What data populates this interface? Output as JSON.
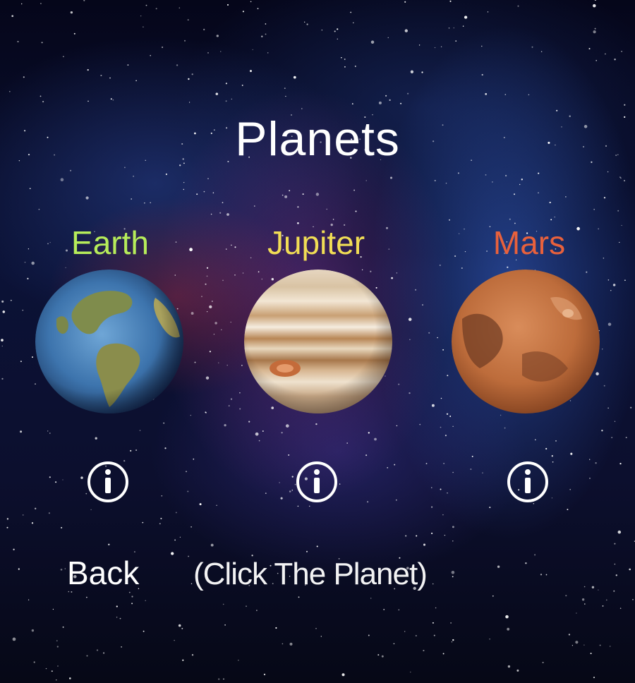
{
  "screen": {
    "title": "Planets"
  },
  "planets": [
    {
      "name": "Earth",
      "color": "#b6ec5a"
    },
    {
      "name": "Jupiter",
      "color": "#f1dd55"
    },
    {
      "name": "Mars",
      "color": "#e8613c"
    }
  ],
  "info_icon": "info-circle-icon",
  "footer": {
    "back_label": "Back",
    "hint": "(Click The Planet)"
  }
}
